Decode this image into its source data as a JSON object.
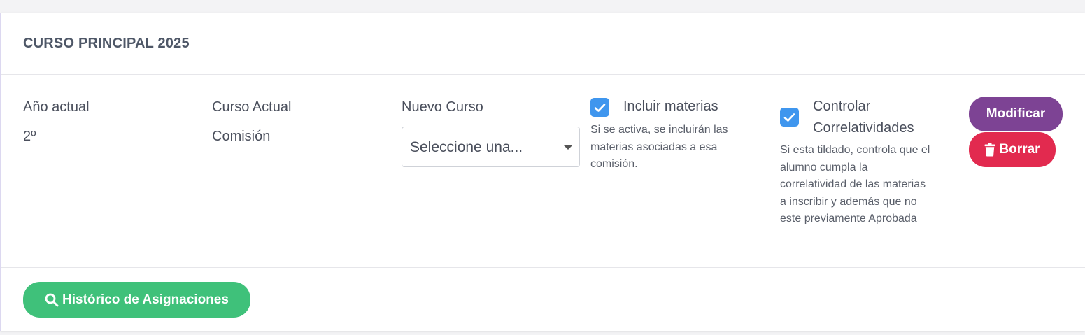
{
  "card": {
    "title": "CURSO PRINCIPAL 2025"
  },
  "columns": {
    "anio": {
      "label": "Año actual",
      "value": "2º"
    },
    "curso": {
      "label": "Curso Actual",
      "value": "Comisión"
    },
    "nuevo": {
      "label": "Nuevo Curso",
      "select_value": "Seleccione una..."
    }
  },
  "incluir": {
    "checked": true,
    "label": "Incluir materias",
    "help_lines": [
      "Si se activa, se incluirán las",
      "materias asociadas a esa",
      "comisión."
    ]
  },
  "controlar": {
    "checked": true,
    "label_lines": [
      "Controlar",
      "Correlatividades"
    ],
    "help_lines": [
      "Si esta tildado, controla que el",
      "alumno cumpla la",
      "correlatividad de las materias",
      "a inscribir y además que no",
      "este previamente Aprobada"
    ]
  },
  "buttons": {
    "modificar": "Modificar",
    "borrar": "Borrar",
    "historico": "Histórico de Asignaciones"
  },
  "colors": {
    "modificar": "#7d4394",
    "borrar": "#e22a4f",
    "historico": "#3fc17a",
    "checkbox": "#3f96ee"
  }
}
